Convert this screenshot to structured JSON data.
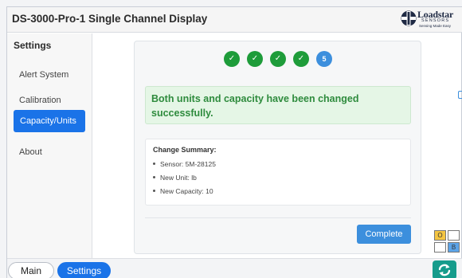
{
  "window": {
    "title": "DS-3000-Pro-1 Single Channel Display"
  },
  "logo": {
    "name": "Loadstar",
    "sensors": "SENSORS",
    "tagline": "Sensing Made Easy"
  },
  "sidebar": {
    "heading": "Settings",
    "items": [
      {
        "label": "Alert System",
        "active": false
      },
      {
        "label": "Calibration",
        "active": false
      },
      {
        "label": "Capacity/Units",
        "active": true
      },
      {
        "label": "About",
        "active": false
      }
    ]
  },
  "stepper": {
    "steps": [
      {
        "label": "✓",
        "state": "done"
      },
      {
        "label": "✓",
        "state": "done"
      },
      {
        "label": "✓",
        "state": "done"
      },
      {
        "label": "✓",
        "state": "done"
      },
      {
        "label": "5",
        "state": "current"
      }
    ]
  },
  "alert": {
    "message": "Both units and capacity have been changed successfully."
  },
  "summary": {
    "title": "Change Summary:",
    "items": [
      "Sensor: 5M-28125",
      "New Unit: lb",
      "New Capacity: 10"
    ]
  },
  "actions": {
    "complete_label": "Complete"
  },
  "indicator": {
    "o_label": "O",
    "b_label": "B"
  },
  "footer": {
    "tabs": [
      {
        "label": "Main",
        "active": false
      },
      {
        "label": "Settings",
        "active": true
      }
    ],
    "refresh_icon": "refresh-icon"
  },
  "colors": {
    "primary": "#1a73e8",
    "success": "#1e9c3a",
    "success_text": "#2e8b3d",
    "button": "#3c8fdd",
    "refresh": "#169c8c"
  }
}
